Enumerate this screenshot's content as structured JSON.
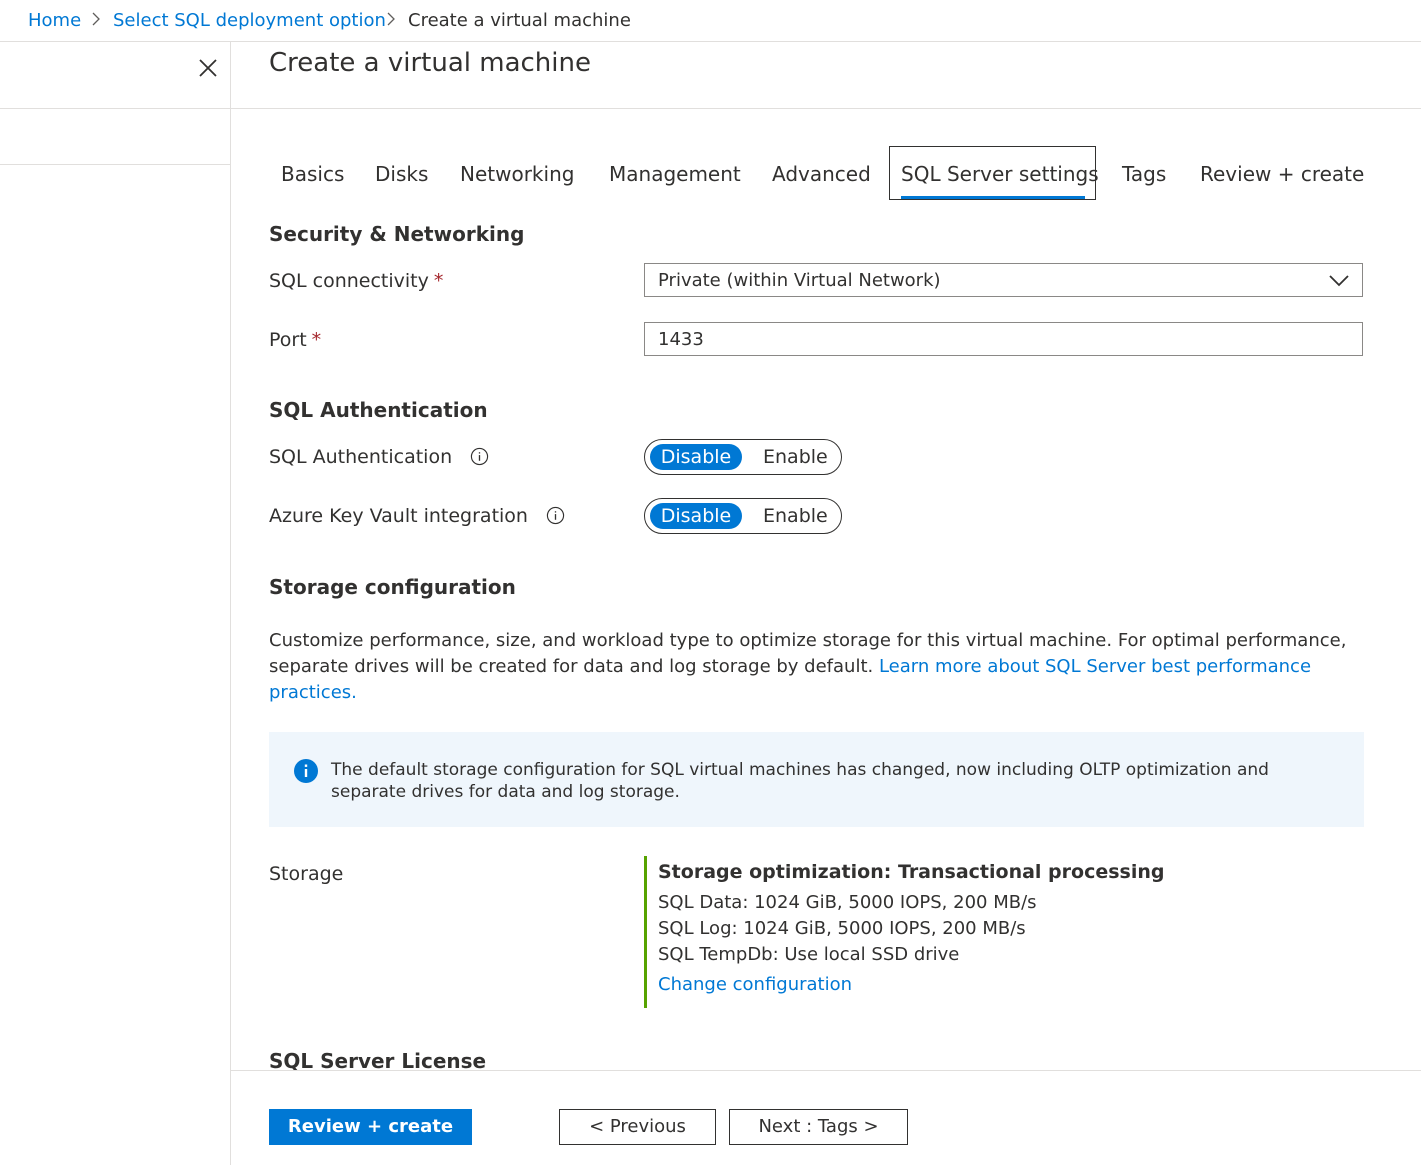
{
  "breadcrumb": {
    "items": [
      "Home",
      "Select SQL deployment option",
      "Create a virtual machine"
    ]
  },
  "page": {
    "title": "Create a virtual machine"
  },
  "tabs": [
    {
      "label": "Basics"
    },
    {
      "label": "Disks"
    },
    {
      "label": "Networking"
    },
    {
      "label": "Management"
    },
    {
      "label": "Advanced"
    },
    {
      "label": "SQL Server settings",
      "active": true
    },
    {
      "label": "Tags"
    },
    {
      "label": "Review + create"
    }
  ],
  "security": {
    "title": "Security & Networking",
    "connectivity_label": "SQL connectivity",
    "connectivity_value": "Private (within Virtual Network)",
    "port_label": "Port",
    "port_value": "1433",
    "required_mark": "*"
  },
  "auth": {
    "title": "SQL Authentication",
    "sql_auth_label": "SQL Authentication",
    "key_vault_label": "Azure Key Vault integration",
    "disable": "Disable",
    "enable": "Enable"
  },
  "storage": {
    "title": "Storage configuration",
    "desc": "Customize performance, size, and workload type to optimize storage for this virtual machine. For optimal performance, separate drives will be created for data and log storage by default. ",
    "desc_link": "Learn more about SQL Server best performance practices.",
    "banner": "The default storage configuration for SQL virtual machines has changed, now including OLTP optimization and separate drives for data and log storage.",
    "label": "Storage",
    "summary_title": "Storage optimization: Transactional processing",
    "data": "SQL Data: 1024 GiB, 5000 IOPS, 200 MB/s",
    "log": "SQL Log: 1024 GiB, 5000 IOPS, 200 MB/s",
    "tempdb": "SQL TempDb: Use local SSD drive",
    "change_link": "Change configuration"
  },
  "license": {
    "title": "SQL Server License"
  },
  "footer": {
    "review_create": "Review + create",
    "previous": "< Previous",
    "next": "Next : Tags >"
  },
  "colors": {
    "accent": "#0078d4",
    "required": "#a4262c",
    "storage_bar": "#57a300",
    "info_bg": "#eff6fc"
  }
}
